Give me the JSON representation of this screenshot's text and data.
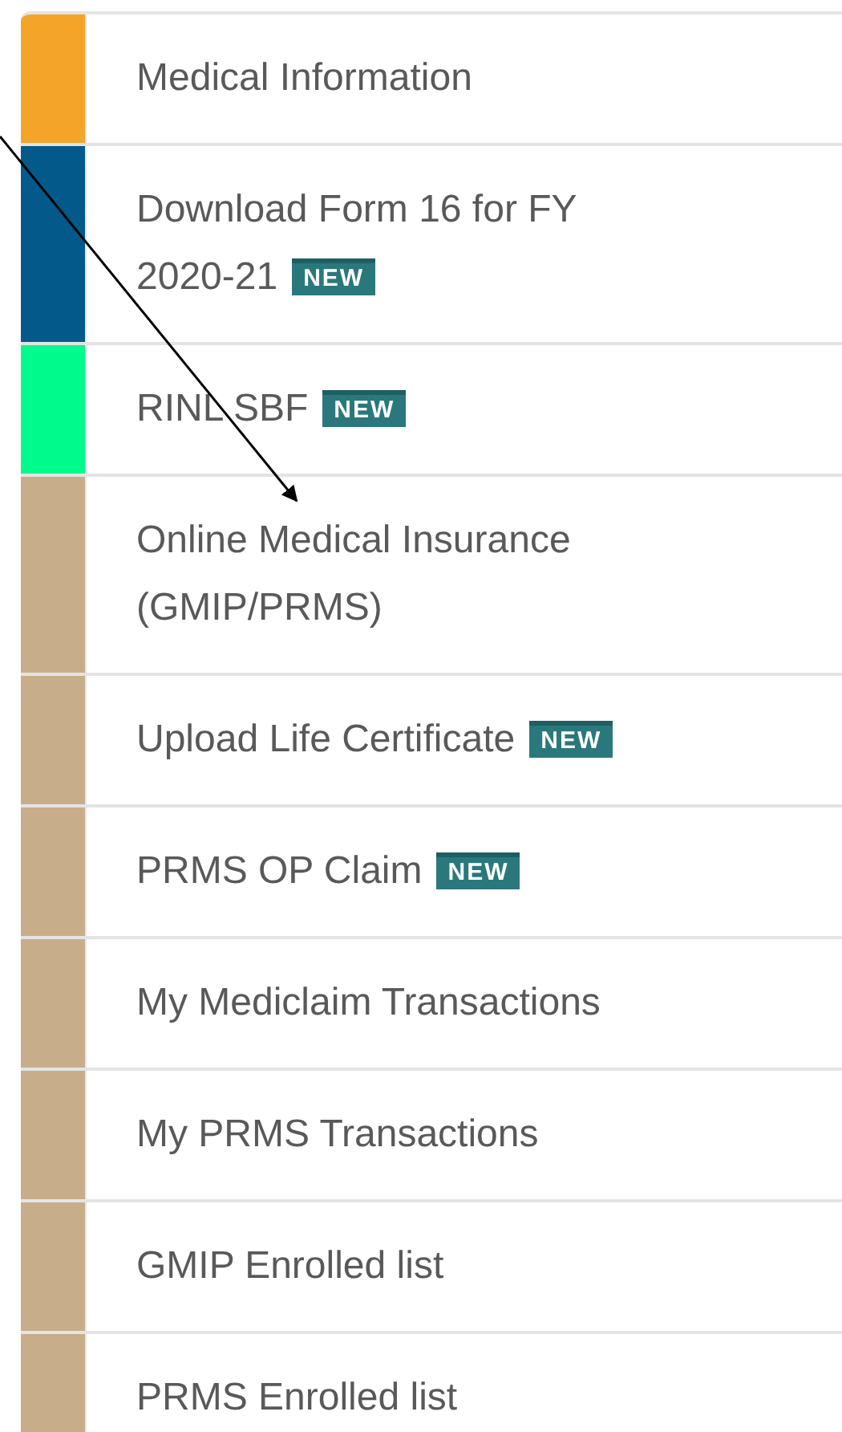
{
  "menu": {
    "items": [
      {
        "label": "Medical Information",
        "color": "#f5a42a"
      },
      {
        "label": "Download Form 16 for FY 2020-21",
        "color": "#035a8a",
        "badge": "NEW"
      },
      {
        "label": "RINL SBF",
        "color": "#00fb8c",
        "badge": "NEW"
      },
      {
        "label": "Online Medical Insurance (GMIP/PRMS)",
        "color": "#c8ad8b"
      },
      {
        "label": "Upload Life Certificate",
        "color": "#c8ad8b",
        "badge": "NEW"
      },
      {
        "label": "PRMS OP Claim",
        "color": "#c8ad8b",
        "badge": "NEW"
      },
      {
        "label": "My Mediclaim Transactions",
        "color": "#c8ad8b"
      },
      {
        "label": "My PRMS Transactions",
        "color": "#c8ad8b"
      },
      {
        "label": "GMIP Enrolled list",
        "color": "#c8ad8b"
      },
      {
        "label": "PRMS Enrolled list",
        "color": "#c8ad8b"
      }
    ]
  }
}
